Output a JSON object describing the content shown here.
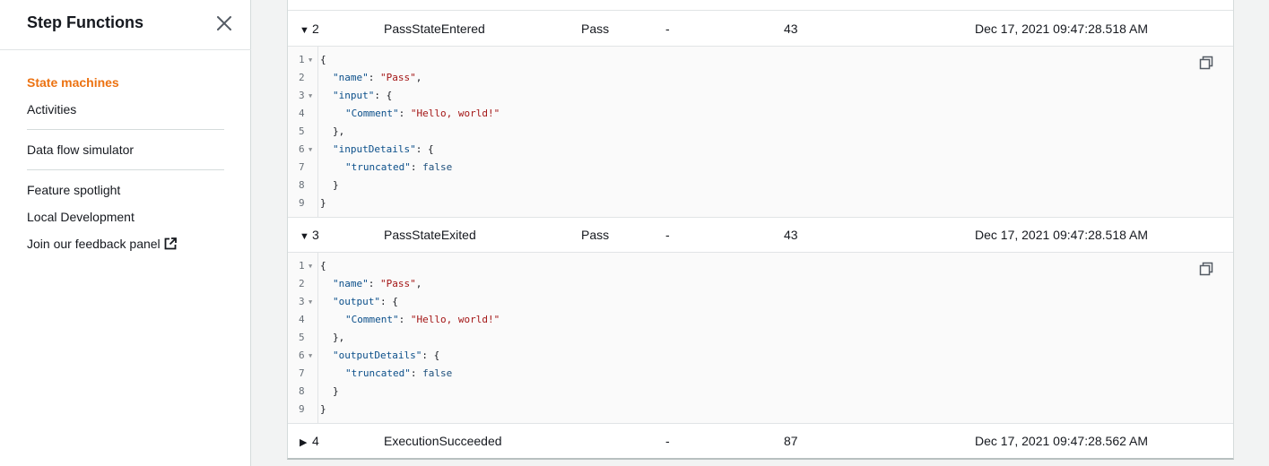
{
  "sidebar": {
    "title": "Step Functions",
    "nav": {
      "state_machines": "State machines",
      "activities": "Activities",
      "data_flow_simulator": "Data flow simulator",
      "feature_spotlight": "Feature spotlight",
      "local_development": "Local Development",
      "feedback_panel": "Join our feedback panel"
    },
    "accent_color": "#ec7211"
  },
  "events": [
    {
      "id": "2",
      "type": "PassStateEntered",
      "resource": "Pass",
      "resource_detail": "-",
      "elapsed_ms": "43",
      "timestamp": "Dec 17, 2021 09:47:28.518 AM",
      "expanded": true
    },
    {
      "id": "3",
      "type": "PassStateExited",
      "resource": "Pass",
      "resource_detail": "-",
      "elapsed_ms": "43",
      "timestamp": "Dec 17, 2021 09:47:28.518 AM",
      "expanded": true
    },
    {
      "id": "4",
      "type": "ExecutionSucceeded",
      "resource": "",
      "resource_detail": "-",
      "elapsed_ms": "87",
      "timestamp": "Dec 17, 2021 09:47:28.562 AM",
      "expanded": false
    }
  ],
  "code_blocks": {
    "entered": {
      "line_numbers": [
        "1",
        "2",
        "3",
        "4",
        "5",
        "6",
        "7",
        "8",
        "9"
      ],
      "name_key": "\"name\"",
      "name_val": "\"Pass\"",
      "obj_key": "\"input\"",
      "comment_key": "\"Comment\"",
      "comment_val": "\"Hello, world!\"",
      "details_key": "\"inputDetails\"",
      "truncated_key": "\"truncated\"",
      "truncated_val": "false"
    },
    "exited": {
      "line_numbers": [
        "1",
        "2",
        "3",
        "4",
        "5",
        "6",
        "7",
        "8",
        "9"
      ],
      "name_key": "\"name\"",
      "name_val": "\"Pass\"",
      "obj_key": "\"output\"",
      "comment_key": "\"Comment\"",
      "comment_val": "\"Hello, world!\"",
      "details_key": "\"outputDetails\"",
      "truncated_key": "\"truncated\"",
      "truncated_val": "false"
    }
  }
}
